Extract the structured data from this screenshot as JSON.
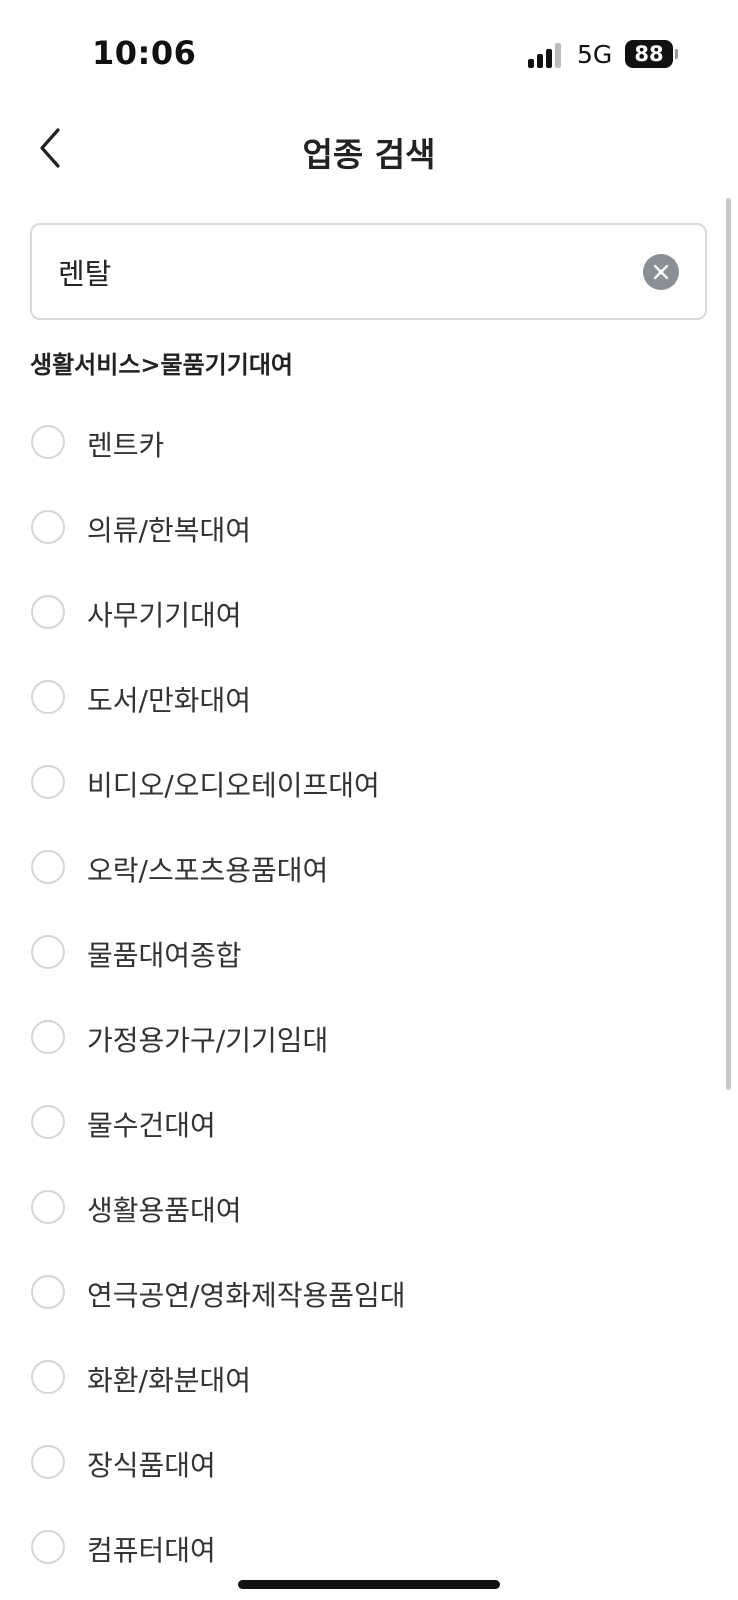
{
  "status_bar": {
    "time": "10:06",
    "network": "5G",
    "battery": "88"
  },
  "header": {
    "title": "업종 검색",
    "back_icon": "chevron-left-icon"
  },
  "search": {
    "value": "렌탈",
    "clear_icon": "clear-circle-icon"
  },
  "category_heading": "생활서비스>물품기기대여",
  "options": [
    {
      "label": "렌트카",
      "selected": false
    },
    {
      "label": "의류/한복대여",
      "selected": false
    },
    {
      "label": "사무기기대여",
      "selected": false
    },
    {
      "label": "도서/만화대여",
      "selected": false
    },
    {
      "label": "비디오/오디오테이프대여",
      "selected": false
    },
    {
      "label": "오락/스포츠용품대여",
      "selected": false
    },
    {
      "label": "물품대여종합",
      "selected": false
    },
    {
      "label": "가정용가구/기기임대",
      "selected": false
    },
    {
      "label": "물수건대여",
      "selected": false
    },
    {
      "label": "생활용품대여",
      "selected": false
    },
    {
      "label": "연극공연/영화제작용품임대",
      "selected": false
    },
    {
      "label": "화환/화분대여",
      "selected": false
    },
    {
      "label": "장식품대여",
      "selected": false
    },
    {
      "label": "컴퓨터대여",
      "selected": false
    }
  ]
}
